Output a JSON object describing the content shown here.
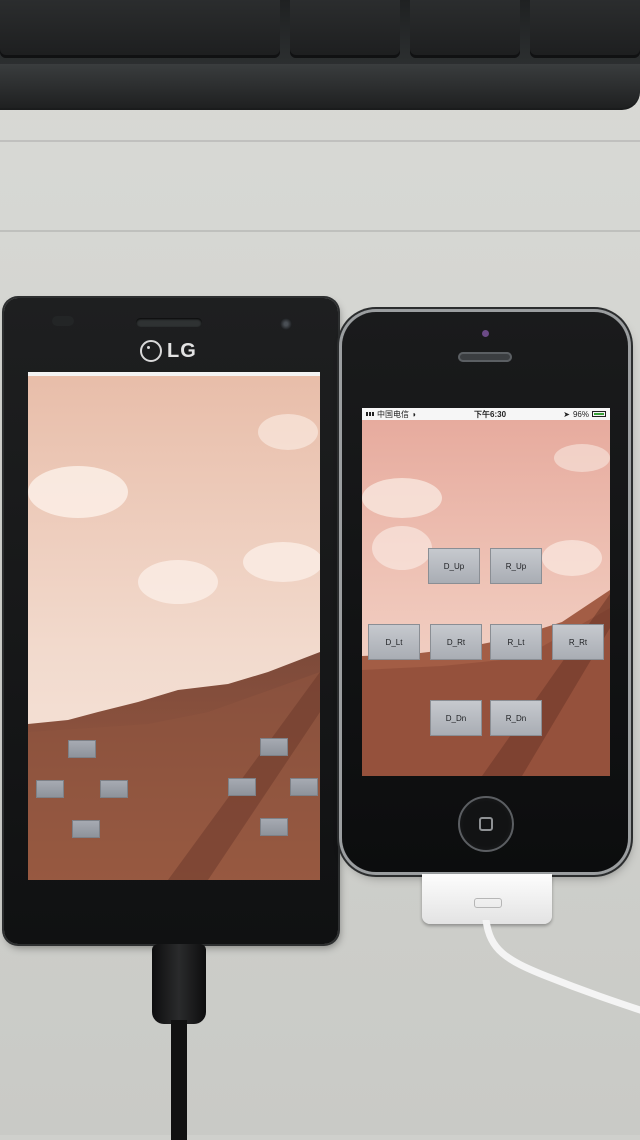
{
  "lg_phone": {
    "brand": "LG",
    "buttons": [
      {
        "label": ""
      },
      {
        "label": ""
      },
      {
        "label": ""
      },
      {
        "label": ""
      },
      {
        "label": ""
      },
      {
        "label": ""
      },
      {
        "label": ""
      },
      {
        "label": ""
      }
    ]
  },
  "iphone": {
    "status_bar": {
      "carrier": "中国电信",
      "time": "下午6:30",
      "battery": "96%"
    },
    "buttons": [
      {
        "label": "D_Up"
      },
      {
        "label": "R_Up"
      },
      {
        "label": "D_Lt"
      },
      {
        "label": "D_Rt"
      },
      {
        "label": "R_Lt"
      },
      {
        "label": "R_Rt"
      },
      {
        "label": "D_Dn"
      },
      {
        "label": "R_Dn"
      }
    ]
  },
  "colors": {
    "sky": "#efd0c4",
    "terrain": "#8e4f3a",
    "button": "#b5b9bf"
  }
}
